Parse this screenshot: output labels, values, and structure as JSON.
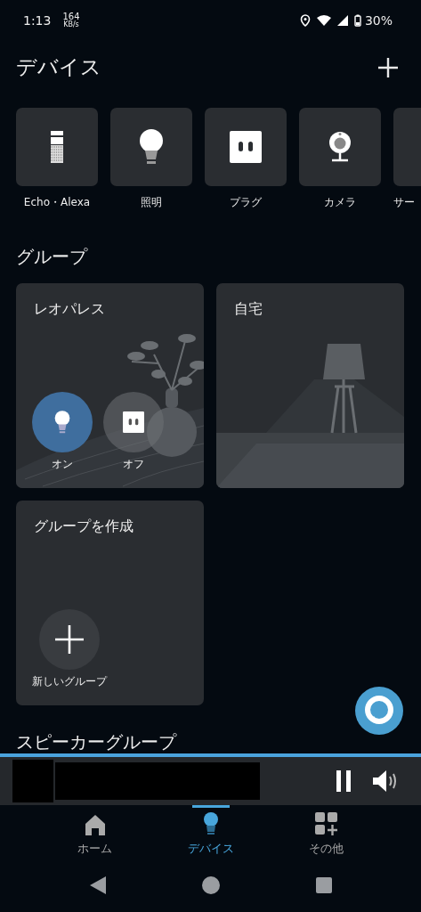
{
  "status_bar": {
    "time": "1:13",
    "speed": "164",
    "speed_unit": "KB/s",
    "battery": "30%"
  },
  "header": {
    "title": "デバイス"
  },
  "devices": [
    {
      "label": "Echo・Alexa",
      "kind": "speaker"
    },
    {
      "label": "照明",
      "kind": "bulb"
    },
    {
      "label": "プラグ",
      "kind": "plug"
    },
    {
      "label": "カメラ",
      "kind": "camera"
    },
    {
      "label": "サー",
      "kind": "blank"
    }
  ],
  "groups_heading": "グループ",
  "groups": [
    {
      "name": "レオパレス",
      "kind": "plant",
      "actions": [
        {
          "label": "オン",
          "kind": "bulb",
          "active": true
        },
        {
          "label": "オフ",
          "kind": "plug",
          "active": false
        }
      ]
    },
    {
      "name": "自宅",
      "kind": "lamp"
    },
    {
      "name": "グループを作成",
      "kind": "create",
      "actions": [
        {
          "label": "新しいグループ",
          "kind": "add"
        }
      ]
    }
  ],
  "speaker_heading": "スピーカーグループ",
  "player": {
    "playing": true
  },
  "nav": [
    {
      "label": "ホーム",
      "kind": "home",
      "selected": false
    },
    {
      "label": "デバイス",
      "kind": "bulb",
      "selected": true
    },
    {
      "label": "その他",
      "kind": "more",
      "selected": false
    }
  ]
}
